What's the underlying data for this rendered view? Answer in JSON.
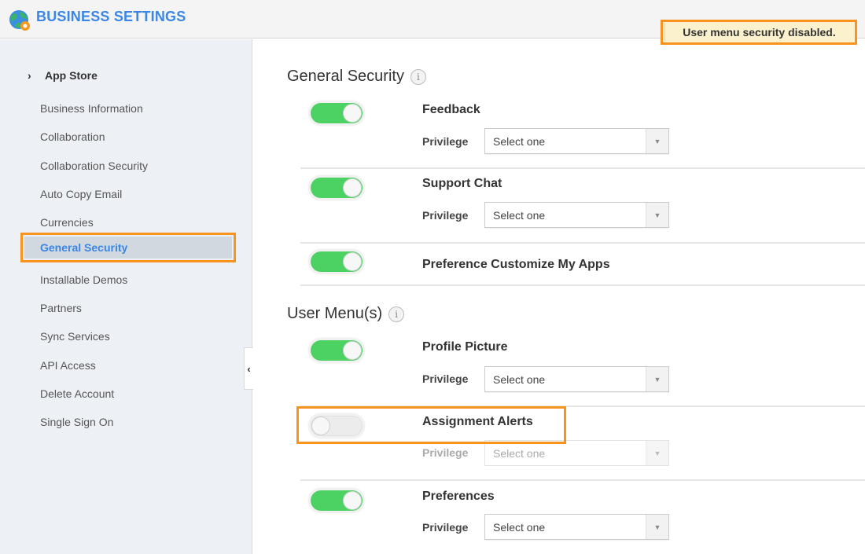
{
  "header": {
    "title": "BUSINESS SETTINGS",
    "logo_icon": "globe-gear-icon",
    "notice": "User menu security disabled."
  },
  "sidebar": {
    "group": {
      "label": "App Store",
      "icon": "chevron-right-icon"
    },
    "items": [
      {
        "label": "Business Information",
        "active": false
      },
      {
        "label": "Collaboration",
        "active": false
      },
      {
        "label": "Collaboration Security",
        "active": false
      },
      {
        "label": "Auto Copy Email",
        "active": false
      },
      {
        "label": "Currencies",
        "active": false
      },
      {
        "label": "General Security",
        "active": true
      },
      {
        "label": "Installable Demos",
        "active": false
      },
      {
        "label": "Partners",
        "active": false
      },
      {
        "label": "Sync Services",
        "active": false
      },
      {
        "label": "API Access",
        "active": false
      },
      {
        "label": "Delete Account",
        "active": false
      },
      {
        "label": "Single Sign On",
        "active": false
      }
    ],
    "collapse_icon": "‹"
  },
  "main": {
    "sections": [
      {
        "title": "General Security",
        "info_icon": "i",
        "rows": [
          {
            "label": "Feedback",
            "enabled": true,
            "privilege_label": "Privilege",
            "privilege_value": "Select one"
          },
          {
            "label": "Support Chat",
            "enabled": true,
            "privilege_label": "Privilege",
            "privilege_value": "Select one"
          },
          {
            "label": "Preference Customize My Apps",
            "enabled": true
          }
        ]
      },
      {
        "title": "User Menu(s)",
        "info_icon": "i",
        "rows": [
          {
            "label": "Profile Picture",
            "enabled": true,
            "privilege_label": "Privilege",
            "privilege_value": "Select one"
          },
          {
            "label": "Assignment Alerts",
            "enabled": false,
            "privilege_label": "Privilege",
            "privilege_value": "Select one"
          },
          {
            "label": "Preferences",
            "enabled": true,
            "privilege_label": "Privilege",
            "privilege_value": "Select one"
          }
        ]
      }
    ],
    "dropdown_arrow": "▼"
  },
  "colors": {
    "accent": "#3a86e6",
    "toggle_on": "#4cd263",
    "highlight": "#f7931e",
    "notice_bg": "#fbf1cc"
  }
}
